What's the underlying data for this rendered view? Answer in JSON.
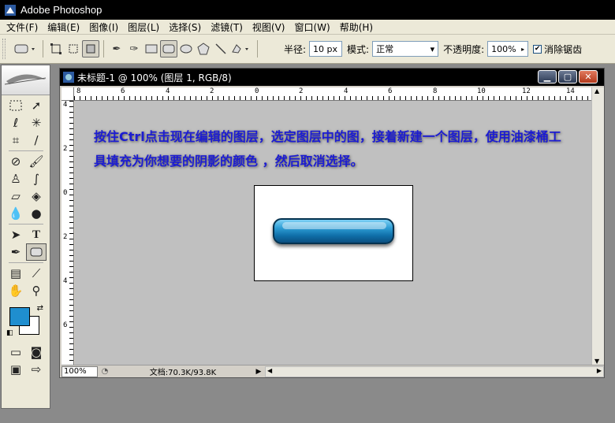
{
  "app": {
    "title": "Adobe Photoshop"
  },
  "menu": [
    "文件(F)",
    "编辑(E)",
    "图像(I)",
    "图层(L)",
    "选择(S)",
    "滤镜(T)",
    "视图(V)",
    "窗口(W)",
    "帮助(H)"
  ],
  "options": {
    "radius_label": "半径:",
    "radius_value": "10 px",
    "mode_label": "模式:",
    "mode_value": "正常",
    "opacity_label": "不透明度:",
    "opacity_value": "100%",
    "antialias_label": "消除锯齿",
    "antialias_checked": true
  },
  "document": {
    "title": "未标题-1 @ 100% (图层 1, RGB/8)",
    "instruction": "按住Ctrl点击现在编辑的图层，选定图层中的图，接着新建一个图层，使用油漆桶工具填充为你想要的阴影的颜色 ，然后取消选择。",
    "hruler_labels": [
      "8",
      "6",
      "4",
      "2",
      "0",
      "2",
      "4",
      "6",
      "8",
      "10",
      "12",
      "14"
    ],
    "vruler_labels": [
      "4",
      "2",
      "0",
      "2",
      "4",
      "6"
    ],
    "status": {
      "zoom": "100%",
      "doc_size": "文档:70.3K/93.8K"
    }
  },
  "colors": {
    "foreground": "#1f8ecf",
    "background": "#ffffff",
    "instruction_text": "#1c1cd2",
    "button_blue": "#0f6ea8"
  }
}
